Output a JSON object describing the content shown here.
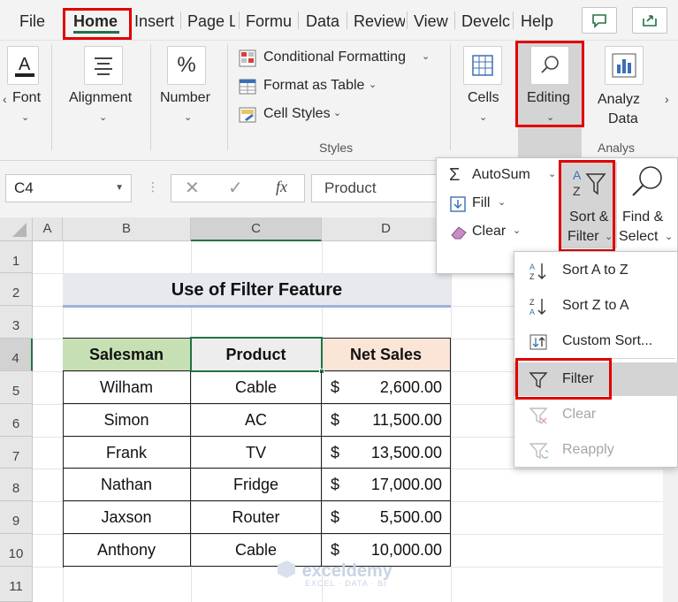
{
  "tabs": [
    "File",
    "Home",
    "Insert",
    "Page L",
    "Formu",
    "Data",
    "Review",
    "View",
    "Develc",
    "Help"
  ],
  "ribbon": {
    "font_label": "Font",
    "alignment_label": "Alignment",
    "number_label": "Number",
    "number_symbol": "%",
    "conditional_formatting": "Conditional Formatting",
    "format_as_table": "Format as Table",
    "cell_styles": "Cell Styles",
    "styles_group": "Styles",
    "cells_label": "Cells",
    "editing_label": "Editing",
    "analyze_label_1": "Analyz",
    "analyze_label_2": "Data",
    "analysis_group": "Analys"
  },
  "formula_bar": {
    "name_box": "C4",
    "fx": "fx",
    "value": "Product"
  },
  "columns": [
    "A",
    "B",
    "C",
    "D"
  ],
  "rows": [
    "1",
    "2",
    "3",
    "4",
    "5",
    "6",
    "7",
    "8",
    "9",
    "10",
    "11"
  ],
  "sheet": {
    "title": "Use of Filter Feature",
    "headers": [
      "Salesman",
      "Product",
      "Net Sales"
    ],
    "currency": "$",
    "data": [
      {
        "salesman": "Wilham",
        "product": "Cable",
        "sales": "2,600.00"
      },
      {
        "salesman": "Simon",
        "product": "AC",
        "sales": "11,500.00"
      },
      {
        "salesman": "Frank",
        "product": "TV",
        "sales": "13,500.00"
      },
      {
        "salesman": "Nathan",
        "product": "Fridge",
        "sales": "17,000.00"
      },
      {
        "salesman": "Jaxson",
        "product": "Router",
        "sales": "5,500.00"
      },
      {
        "salesman": "Anthony",
        "product": "Cable",
        "sales": "10,000.00"
      }
    ]
  },
  "editing_popup": {
    "autosum": "AutoSum",
    "fill": "Fill",
    "clear": "Clear",
    "sort_filter_1": "Sort &",
    "sort_filter_2": "Filter",
    "find_select_1": "Find &",
    "find_select_2": "Select"
  },
  "sort_menu": {
    "sort_a_z": "Sort A to Z",
    "sort_z_a": "Sort Z to A",
    "custom_sort": "Custom Sort...",
    "filter": "Filter",
    "clear": "Clear",
    "reapply": "Reapply"
  },
  "watermark": {
    "brand": "exceldemy",
    "tagline": "EXCEL · DATA · BI"
  },
  "colors": {
    "salesman_header": "#c6e0b4",
    "product_header": "#ededed",
    "sales_header": "#fbe5d6",
    "accent_green": "#217346",
    "highlight_red": "#e00000"
  }
}
